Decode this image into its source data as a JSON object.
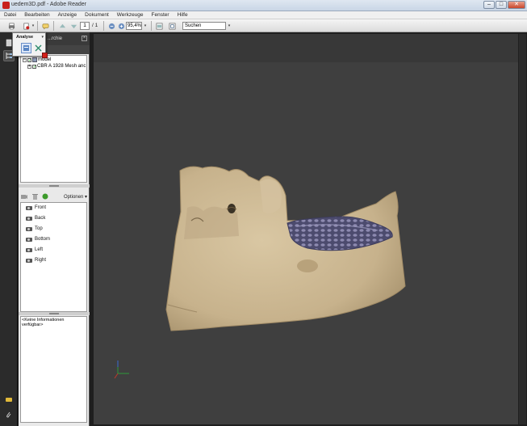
{
  "window": {
    "title": "uedem3D.pdf - Adobe Reader",
    "minimize": "–",
    "maximize": "□",
    "close": "✕"
  },
  "menu": [
    "Datei",
    "Bearbeiten",
    "Anzeige",
    "Dokument",
    "Werkzeuge",
    "Fenster",
    "Hilfe"
  ],
  "toolbar": {
    "page_current": "1",
    "page_total": "/ 1",
    "zoom": "95,4%",
    "search_placeholder": "Suchen"
  },
  "flyout": {
    "label": "Analyse",
    "arrow": "▾"
  },
  "panel": {
    "title": "...rchie",
    "close": "×",
    "tree": [
      {
        "label": "model",
        "checked": "✓"
      },
      {
        "label": "CBR A 1928 Mesh anc",
        "checked": "✓"
      }
    ],
    "options_label": "Optionen ▾",
    "views": [
      "Front",
      "Back",
      "Top",
      "Bottom",
      "Left",
      "Right"
    ],
    "info_text": "<Keine Informationen verfügbar>"
  },
  "colors": {
    "bone": "#c9b693",
    "mesh": "#5f5e86",
    "canvas": "#3f3f3f"
  }
}
